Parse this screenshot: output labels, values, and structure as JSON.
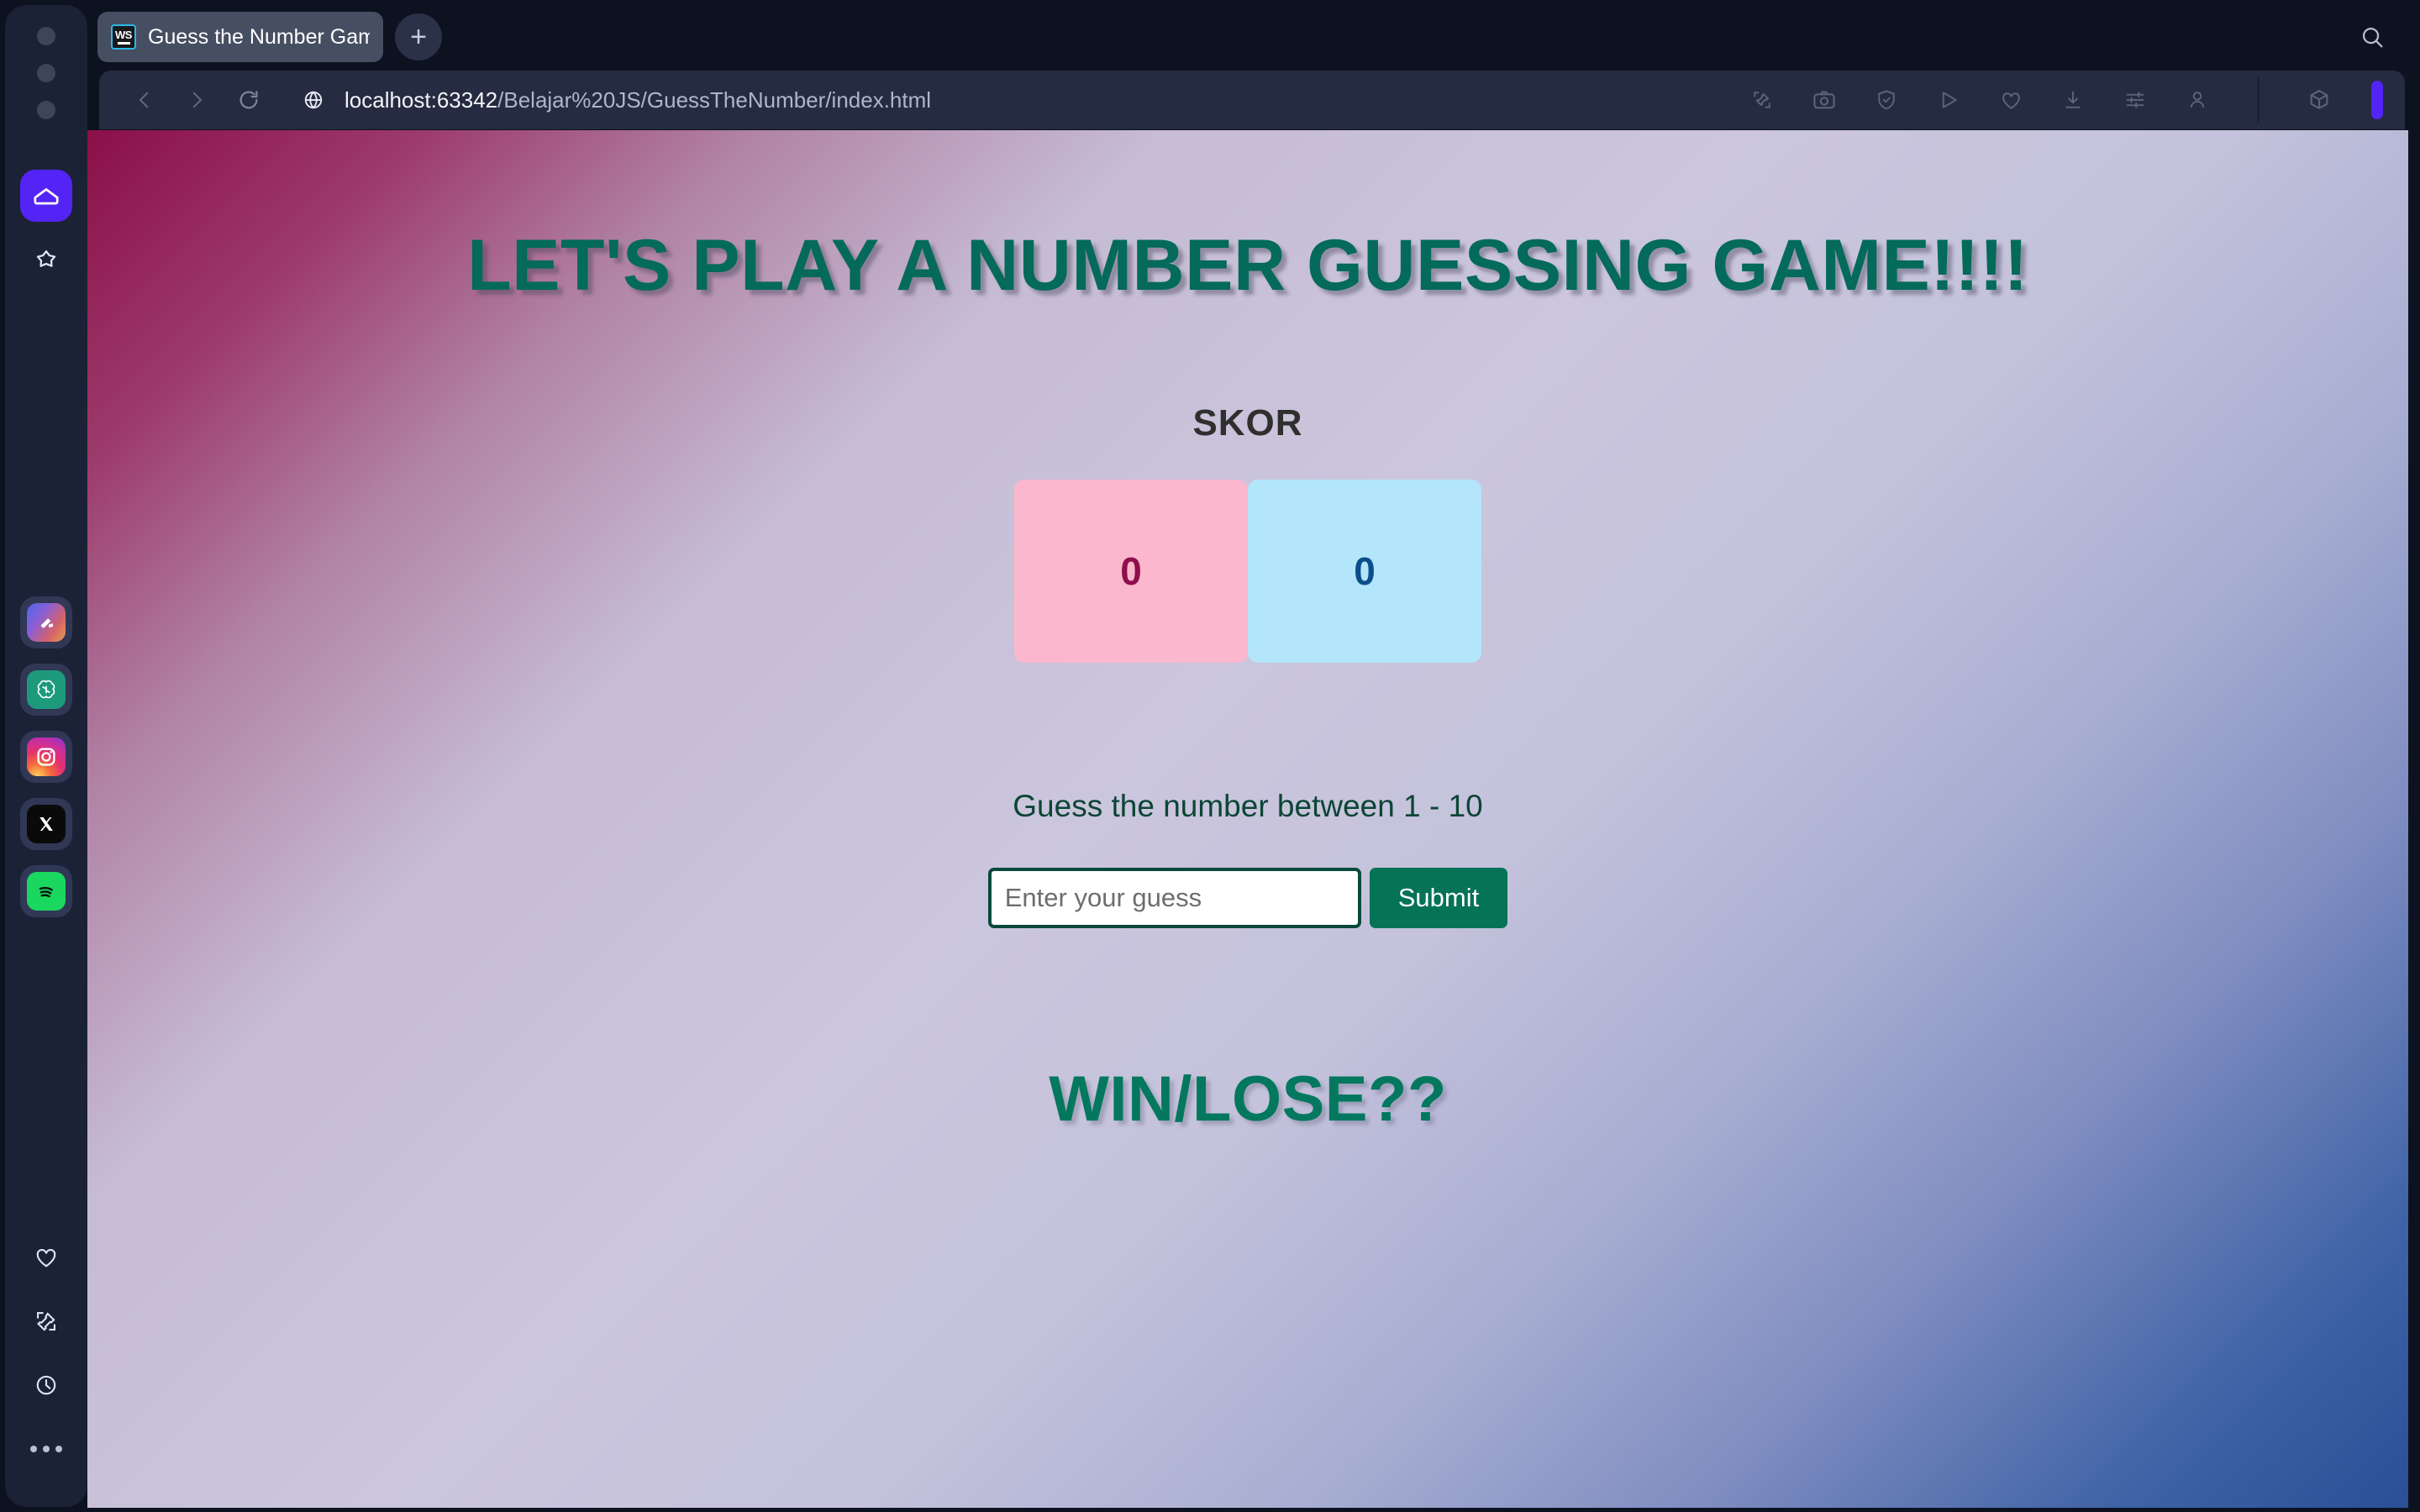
{
  "window": {
    "controls": [
      "close",
      "minimize",
      "maximize"
    ]
  },
  "sidebar": {
    "top_items": [
      {
        "name": "home",
        "icon": "home-icon",
        "active": true
      },
      {
        "name": "bookmarks",
        "icon": "star-icon",
        "active": false
      }
    ],
    "apps": [
      {
        "name": "claude",
        "icon": "claude-app-icon"
      },
      {
        "name": "chatgpt",
        "icon": "chatgpt-app-icon"
      },
      {
        "name": "instagram",
        "icon": "instagram-app-icon"
      },
      {
        "name": "x",
        "icon": "x-app-icon"
      },
      {
        "name": "spotify",
        "icon": "spotify-app-icon"
      }
    ],
    "bottom_items": [
      {
        "name": "favorites",
        "icon": "heart-icon"
      },
      {
        "name": "pinned-notes",
        "icon": "pin-icon"
      },
      {
        "name": "history",
        "icon": "clock-icon"
      },
      {
        "name": "more",
        "icon": "more-dots-icon"
      }
    ]
  },
  "tabbar": {
    "tabs": [
      {
        "title": "Guess the Number Game",
        "favicon": "webstorm-ws-icon",
        "active": true
      }
    ],
    "new_tab_label": "+",
    "search_icon": "search-icon"
  },
  "urlbar": {
    "back_icon": "chevron-left-icon",
    "forward_icon": "chevron-right-icon",
    "reload_icon": "reload-icon",
    "site_icon": "globe-icon",
    "url_host": "localhost:63342",
    "url_path": "/Belajar%20JS/GuessTheNumber/index.html",
    "url_full": "localhost:63342/Belajar%20JS/GuessTheNumber/index.html",
    "tools": [
      {
        "name": "annotate",
        "icon": "edit-pin-icon"
      },
      {
        "name": "screenshot",
        "icon": "camera-icon"
      },
      {
        "name": "shield",
        "icon": "shield-check-icon"
      },
      {
        "name": "send",
        "icon": "send-icon"
      },
      {
        "name": "favorite",
        "icon": "heart-icon"
      },
      {
        "name": "downloads",
        "icon": "download-icon"
      },
      {
        "name": "settings",
        "icon": "sliders-icon"
      },
      {
        "name": "profile",
        "icon": "user-icon"
      },
      {
        "name": "extensions",
        "icon": "cube-icon"
      }
    ]
  },
  "page": {
    "headline": "LET'S PLAY A NUMBER GUESSING GAME!!!!",
    "score_label": "SKOR",
    "scores": [
      {
        "name": "player-score",
        "value": "0",
        "bg": "#fab7cd",
        "fg": "#8e0f4c"
      },
      {
        "name": "computer-score",
        "value": "0",
        "bg": "#b3e5fb",
        "fg": "#0c4d89"
      }
    ],
    "prompt": "Guess the number between 1 - 10",
    "input_placeholder": "Enter your guess",
    "input_value": "",
    "submit_label": "Submit",
    "result_text": "WIN/LOSE??"
  },
  "colors": {
    "accent_purple": "#5324f5",
    "teal_heading": "#046a5a",
    "teal_result": "#03785e",
    "button_green": "#047356",
    "chrome_bg": "#0d1220",
    "rail_bg": "#1c2236",
    "urlbar_bg": "#252b40",
    "tab_bg": "#464e62",
    "gradient_start": "#8b0f49",
    "gradient_mid": "#cbc6dd",
    "gradient_end": "#2a4f97"
  }
}
